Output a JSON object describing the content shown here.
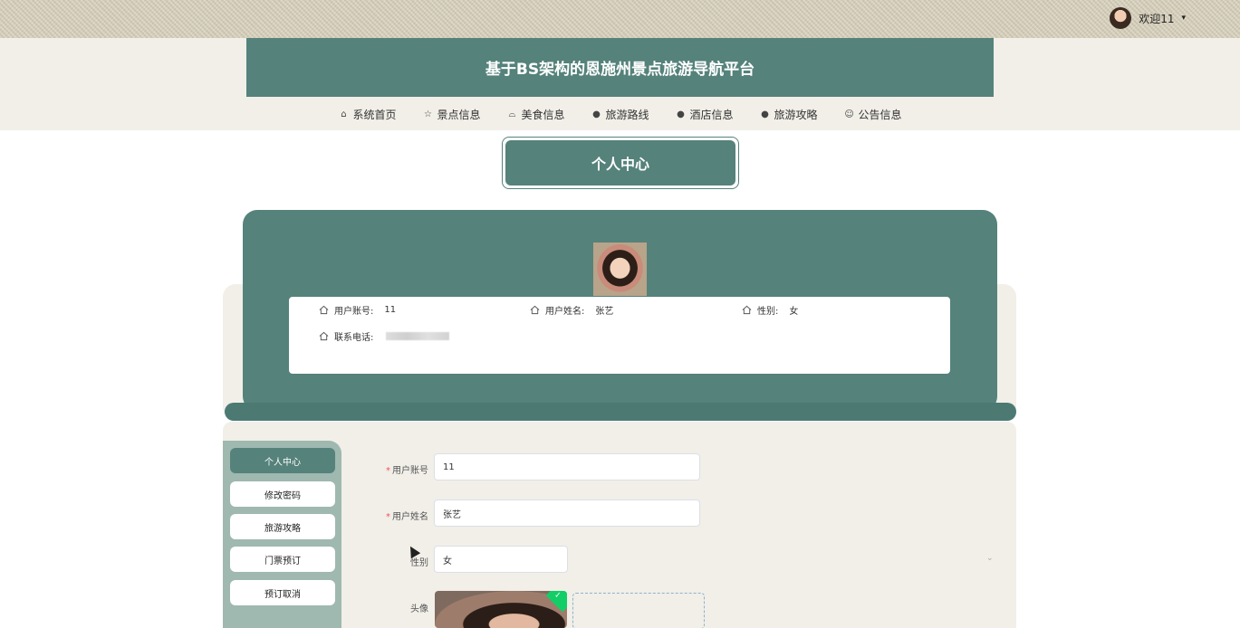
{
  "header": {
    "welcome": "欢迎11",
    "title": "基于BS架构的恩施州景点旅游导航平台"
  },
  "nav": [
    {
      "label": "系统首页",
      "icon": "home-icon",
      "glyph": "⌂"
    },
    {
      "label": "景点信息",
      "icon": "star-icon",
      "glyph": "☆"
    },
    {
      "label": "美食信息",
      "icon": "bag-icon",
      "glyph": "⌓"
    },
    {
      "label": "旅游路线",
      "icon": "info-circle-icon",
      "glyph": "●"
    },
    {
      "label": "酒店信息",
      "icon": "question-circle-icon",
      "glyph": "●"
    },
    {
      "label": "旅游攻略",
      "icon": "info-circle-icon",
      "glyph": "●"
    },
    {
      "label": "公告信息",
      "icon": "smile-icon",
      "glyph": "☺"
    }
  ],
  "section_title": "个人中心",
  "profile": {
    "account_label": "用户账号:",
    "account_value": "11",
    "name_label": "用户姓名:",
    "name_value": "张艺",
    "gender_label": "性别:",
    "gender_value": "女",
    "phone_label": "联系电话:"
  },
  "sidebar": [
    "个人中心",
    "修改密码",
    "旅游攻略",
    "门票预订",
    "预订取消"
  ],
  "form": {
    "account_label": "用户账号",
    "account_value": "11",
    "name_label": "用户姓名",
    "name_value": "张艺",
    "gender_label": "性别",
    "gender_value": "女",
    "avatar_label": "头像",
    "required_mark": "*"
  },
  "colors": {
    "accent": "#55827b",
    "background": "#f1efe8"
  }
}
